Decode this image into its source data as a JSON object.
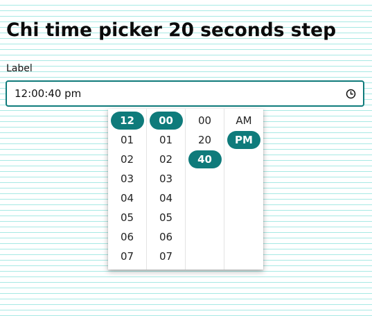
{
  "page": {
    "title": "Chi time picker 20 seconds step"
  },
  "field": {
    "label": "Label",
    "value": "12:00:40 pm",
    "icon": "clock-icon"
  },
  "picker": {
    "accent_color": "#0f7b7b",
    "hours": {
      "selected": "12",
      "items": [
        "12",
        "01",
        "02",
        "03",
        "04",
        "05",
        "06",
        "07"
      ]
    },
    "minutes": {
      "selected": "00",
      "items": [
        "00",
        "01",
        "02",
        "03",
        "04",
        "05",
        "06",
        "07"
      ]
    },
    "seconds": {
      "selected": "40",
      "items": [
        "00",
        "20",
        "40"
      ]
    },
    "period": {
      "selected": "PM",
      "items": [
        "AM",
        "PM"
      ]
    }
  }
}
